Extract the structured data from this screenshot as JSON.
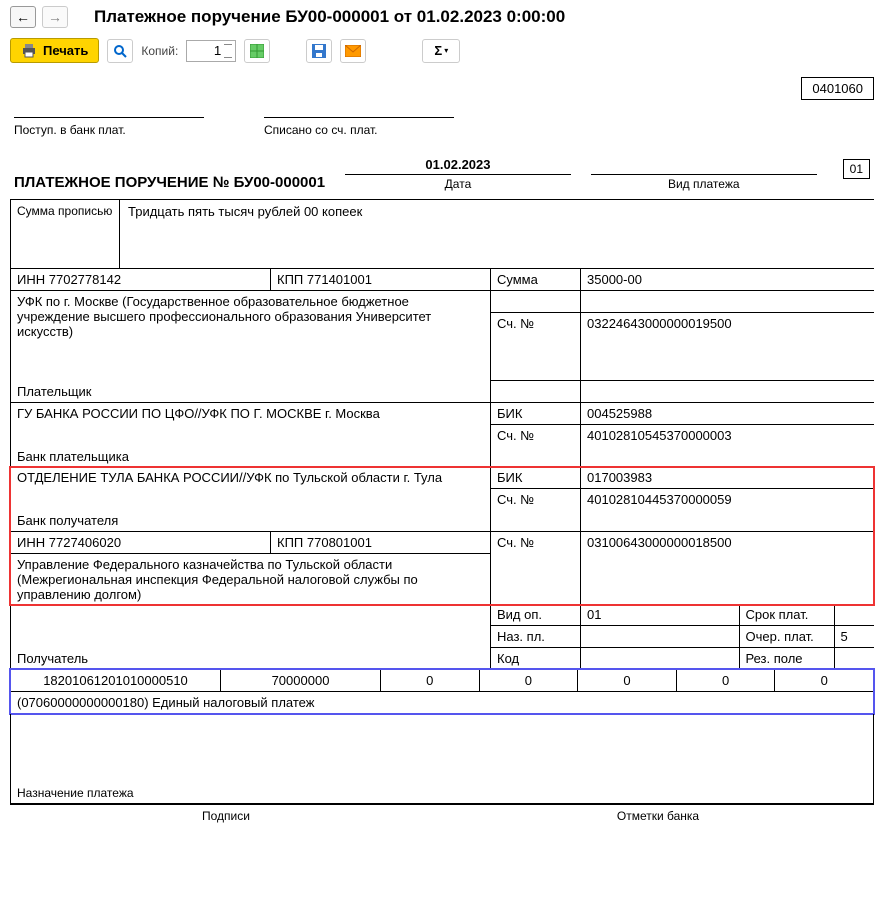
{
  "header": {
    "title": "Платежное поручение БУ00-000001 от 01.02.2023 0:00:00",
    "print_label": "Печать",
    "copies_label": "Копий:",
    "copies_value": "1",
    "sigma": "Σ"
  },
  "doc": {
    "form_code": "0401060",
    "hdr_in_bank": "Поступ. в банк плат.",
    "hdr_debited": "Списано со сч. плат.",
    "title": "ПЛАТЕЖНОЕ ПОРУЧЕНИЕ № БУ00-000001",
    "date": "01.02.2023",
    "date_lbl": "Дата",
    "type_lbl": "Вид платежа",
    "type_val": "",
    "num01": "01",
    "sum_words_lbl": "Сумма прописью",
    "sum_words": "Тридцать пять тысяч рублей 00 копеек",
    "payer": {
      "inn_lbl": "ИНН",
      "inn": "7702778142",
      "kpp_lbl": "КПП",
      "kpp": "771401001",
      "name": "УФК по г. Москве (Государственное образовательное бюджетное учреждение высшего профессионального образования Университет искусств)",
      "lbl": "Плательщик",
      "bank_name": "ГУ БАНКА РОССИИ ПО ЦФО//УФК ПО Г. МОСКВЕ г. Москва",
      "bank_lbl": "Банк плательщика",
      "sum_lbl": "Сумма",
      "sum": "35000-00",
      "acc_lbl": "Сч. №",
      "acc": "03224643000000019500",
      "bik_lbl": "БИК",
      "bik": "004525988",
      "bank_acc": "40102810545370000003"
    },
    "payee": {
      "bank_name": "ОТДЕЛЕНИЕ ТУЛА БАНКА РОССИИ//УФК по Тульской области г. Тула",
      "bank_lbl": "Банк получателя",
      "bik_lbl": "БИК",
      "bik": "017003983",
      "bank_acc_lbl": "Сч. №",
      "bank_acc": "40102810445370000059",
      "inn_lbl": "ИНН",
      "inn": "7727406020",
      "kpp_lbl": "КПП",
      "kpp": "770801001",
      "acc_lbl": "Сч. №",
      "acc": "03100643000000018500",
      "name": "Управление Федерального казначейства по Тульской области (Межрегиональная инспекция Федеральной налоговой службы по управлению долгом)",
      "lbl": "Получатель"
    },
    "ops": {
      "vid_op_lbl": "Вид оп.",
      "vid_op": "01",
      "srok_lbl": "Срок плат.",
      "naz_pl_lbl": "Наз. пл.",
      "ocher_lbl": "Очер. плат.",
      "ocher": "5",
      "kod_lbl": "Код",
      "rez_lbl": "Рез. поле"
    },
    "codes": {
      "c1": "18201061201010000510",
      "c2": "70000000",
      "c3": "0",
      "c4": "0",
      "c5": "0",
      "c6": "0",
      "c7": "0"
    },
    "purpose": "(07060000000000180) Единый налоговый платеж",
    "purpose_lbl": "Назначение платежа",
    "footer": {
      "sign": "Подписи",
      "bank": "Отметки банка"
    }
  }
}
